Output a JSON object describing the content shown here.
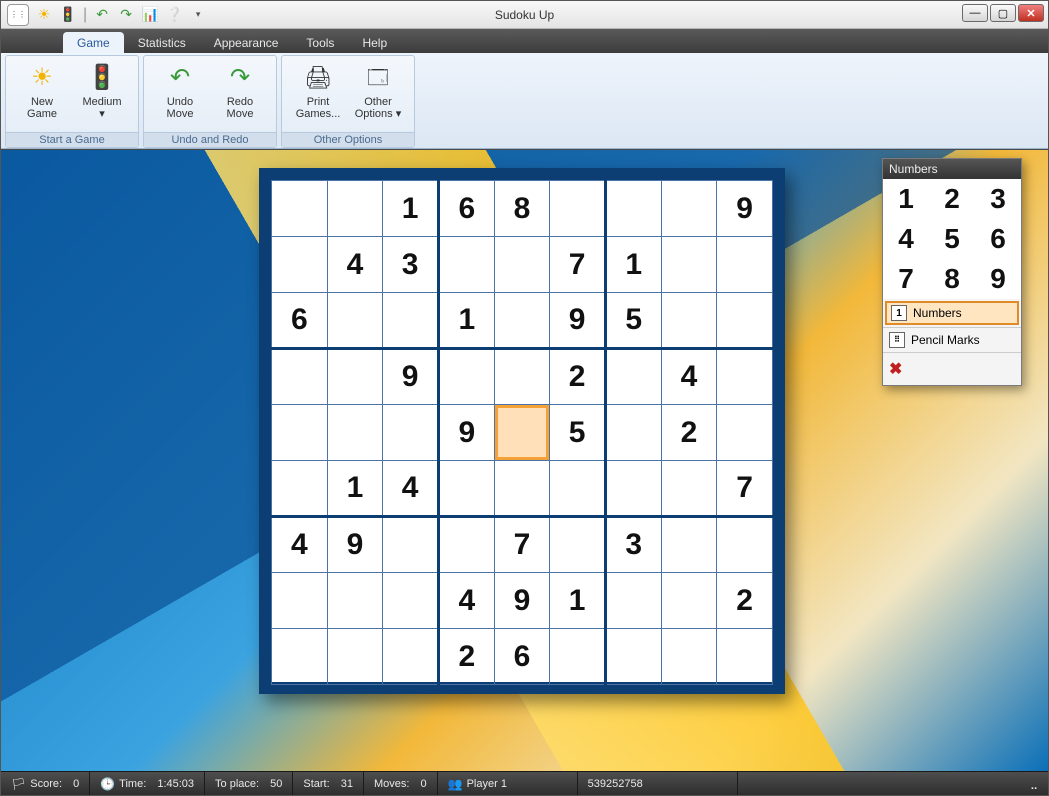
{
  "app": {
    "title": "Sudoku Up"
  },
  "tabs": {
    "game": "Game",
    "statistics": "Statistics",
    "appearance": "Appearance",
    "tools": "Tools",
    "help": "Help"
  },
  "ribbon": {
    "new_game": "New\nGame",
    "difficulty": "Medium",
    "group_start": "Start a Game",
    "undo": "Undo\nMove",
    "redo": "Redo\nMove",
    "group_undo": "Undo and Redo",
    "print": "Print\nGames...",
    "other": "Other\nOptions",
    "group_other": "Other Options"
  },
  "palette": {
    "title": "Numbers",
    "n1": "1",
    "n2": "2",
    "n3": "3",
    "n4": "4",
    "n5": "5",
    "n6": "6",
    "n7": "7",
    "n8": "8",
    "n9": "9",
    "mode_numbers": "Numbers",
    "mode_pencil": "Pencil Marks"
  },
  "status": {
    "score_label": "Score:",
    "score_value": "0",
    "time_label": "Time:",
    "time_value": "1:45:03",
    "toplace_label": "To place:",
    "toplace_value": "50",
    "start_label": "Start:",
    "start_value": "31",
    "moves_label": "Moves:",
    "moves_value": "0",
    "player_label": "Player 1",
    "seed": "539252758"
  },
  "sudoku": {
    "selected": [
      4,
      4
    ],
    "grid": [
      [
        "",
        "",
        "1",
        "6",
        "8",
        "",
        "",
        "",
        "9"
      ],
      [
        "",
        "4",
        "3",
        "",
        "",
        "7",
        "1",
        "",
        ""
      ],
      [
        "6",
        "",
        "",
        "1",
        "",
        "9",
        "5",
        "",
        ""
      ],
      [
        "",
        "",
        "9",
        "",
        "",
        "2",
        "",
        "4",
        ""
      ],
      [
        "",
        "",
        "",
        "9",
        "",
        "5",
        "",
        "2",
        ""
      ],
      [
        "",
        "1",
        "4",
        "",
        "",
        "",
        "",
        "",
        "7"
      ],
      [
        "4",
        "9",
        "",
        "",
        "7",
        "",
        "3",
        "",
        ""
      ],
      [
        "",
        "",
        "",
        "4",
        "9",
        "1",
        "",
        "",
        "2"
      ],
      [
        "",
        "",
        "",
        "2",
        "6",
        "",
        "",
        "",
        ""
      ]
    ]
  }
}
